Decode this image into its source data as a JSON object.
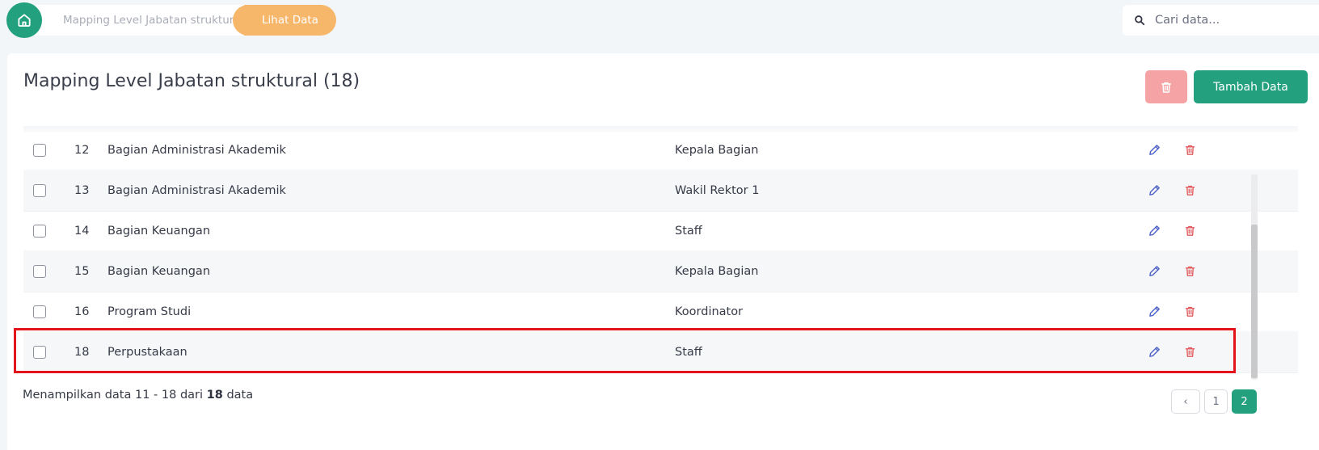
{
  "breadcrumb": {
    "items": [
      "Mapping Level Jabatan struktural"
    ],
    "active": "Lihat Data"
  },
  "search": {
    "placeholder": "Cari data..."
  },
  "card": {
    "title": "Mapping Level Jabatan struktural (18)",
    "add_button": "Tambah Data"
  },
  "rows": [
    {
      "no": "12",
      "unit": "Bagian Administrasi Akademik",
      "level": "Kepala Bagian"
    },
    {
      "no": "13",
      "unit": "Bagian Administrasi Akademik",
      "level": "Wakil Rektor 1"
    },
    {
      "no": "14",
      "unit": "Bagian Keuangan",
      "level": "Staff"
    },
    {
      "no": "15",
      "unit": "Bagian Keuangan",
      "level": "Kepala Bagian"
    },
    {
      "no": "16",
      "unit": "Program Studi",
      "level": "Koordinator"
    },
    {
      "no": "18",
      "unit": "Perpustakaan",
      "level": "Staff"
    }
  ],
  "footer": {
    "info_prefix": "Menampilkan data 11 - 18 dari",
    "total": "18",
    "info_suffix": "data"
  },
  "pagination": {
    "prev": "‹",
    "pages": [
      "1",
      "2"
    ],
    "current": "2"
  },
  "colors": {
    "primary": "#23a07e",
    "accent": "#f7b76b",
    "danger": "#e25c5f",
    "edit": "#4f62c9",
    "highlight": "#e3141b"
  },
  "icons": {
    "home": "home-icon",
    "search": "search-icon",
    "edit": "pencil-icon",
    "delete": "trash-icon"
  }
}
